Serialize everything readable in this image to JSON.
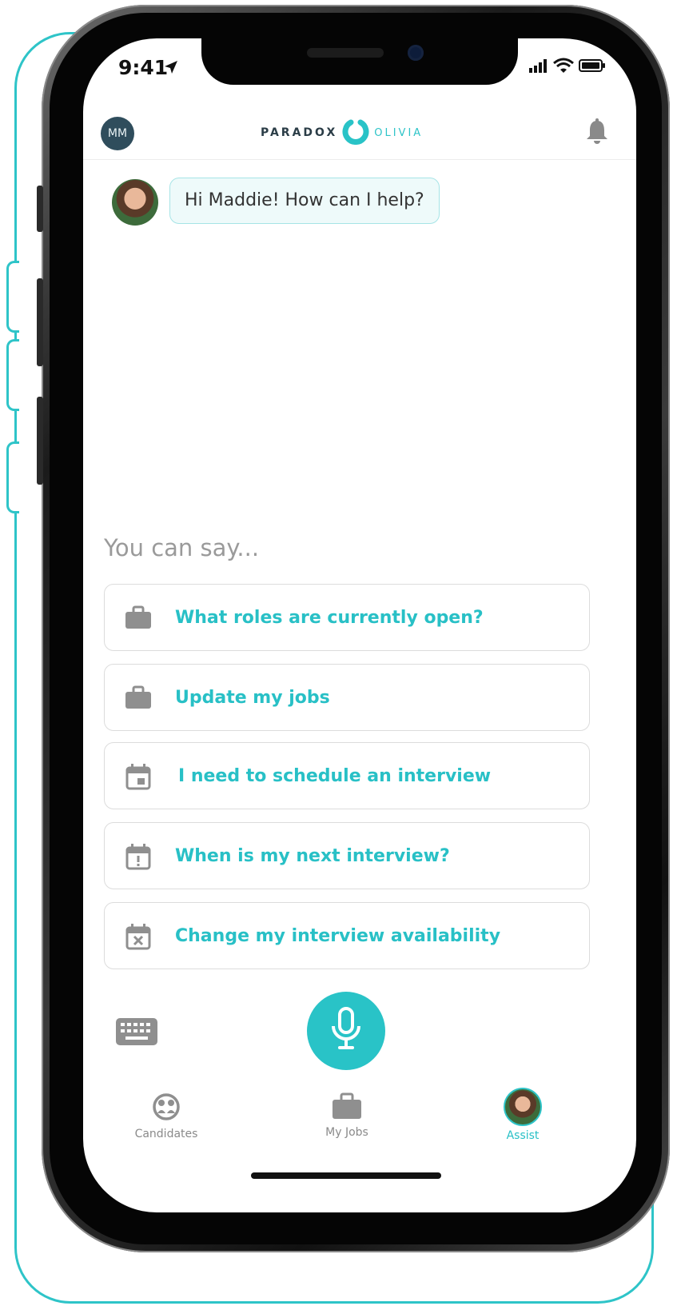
{
  "status_bar": {
    "time": "9:41"
  },
  "header": {
    "user_initials": "MM",
    "brand_left": "PARADOX",
    "brand_right": "OLIVIA"
  },
  "chat": {
    "greeting": "Hi Maddie! How can I help?"
  },
  "suggestions": {
    "heading": "You can say...",
    "items": [
      {
        "label": "What roles are currently open?",
        "icon": "briefcase-icon"
      },
      {
        "label": "Update my jobs",
        "icon": "briefcase-icon"
      },
      {
        "label": "I need to schedule an interview",
        "icon": "calendar-icon"
      },
      {
        "label": "When is my next interview?",
        "icon": "calendar-alert-icon"
      },
      {
        "label": "Change my interview availability",
        "icon": "calendar-cancel-icon"
      }
    ]
  },
  "tab_bar": {
    "tabs": [
      {
        "label": "Candidates",
        "icon": "candidates-icon"
      },
      {
        "label": "My Jobs",
        "icon": "briefcase-icon"
      },
      {
        "label": "Assist",
        "icon": "assist-avatar"
      }
    ]
  },
  "colors": {
    "accent": "#28c0c6",
    "muted": "#9a9a9a",
    "avatar_bg": "#2f4d5c"
  }
}
